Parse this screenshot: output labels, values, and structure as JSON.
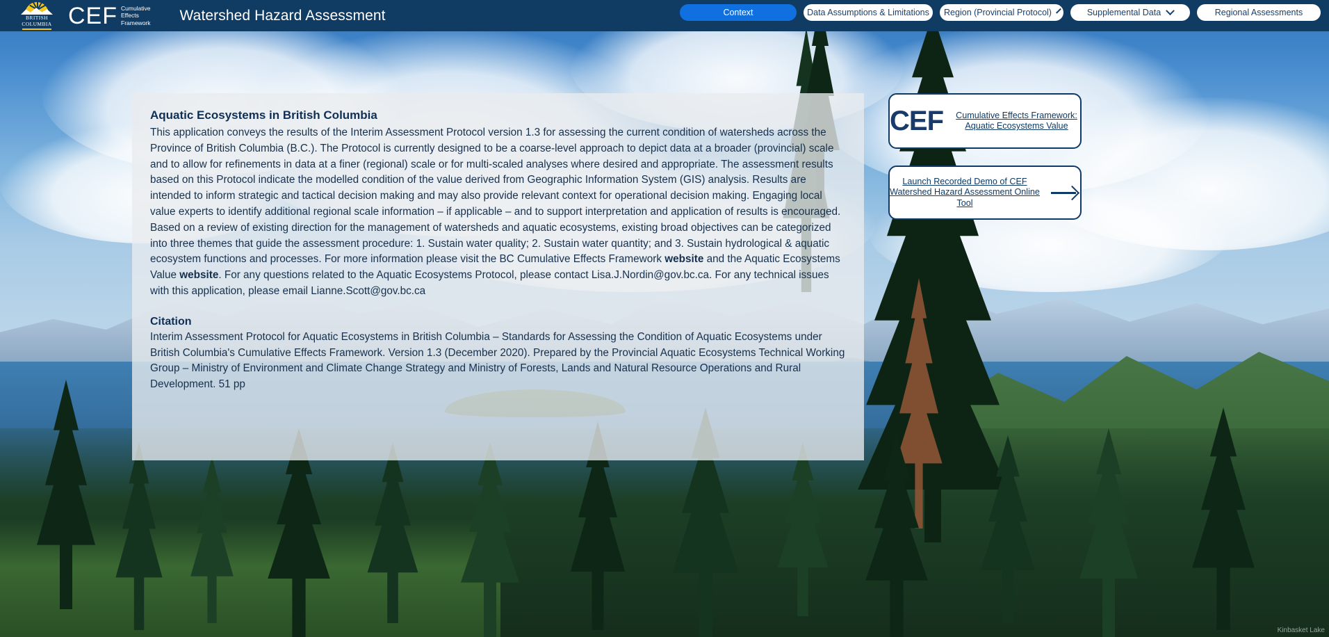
{
  "header": {
    "logo_text_lines": [
      "BRITISH",
      "COLUMBIA"
    ],
    "cef_acronym": "CEF",
    "cef_words": [
      "Cumulative",
      "Effects",
      "Framework"
    ],
    "app_title": "Watershed Hazard Assessment",
    "nav": [
      {
        "label": "Context",
        "active": true,
        "has_chevron": false
      },
      {
        "label": "Data Assumptions & Limitations",
        "active": false,
        "has_chevron": false
      },
      {
        "label": "Region (Provincial Protocol)",
        "active": false,
        "has_chevron": true
      },
      {
        "label": "Supplemental Data",
        "active": false,
        "has_chevron": true
      },
      {
        "label": "Regional Assessments",
        "active": false,
        "has_chevron": false
      }
    ]
  },
  "panel": {
    "title": "Aquatic Ecosystems in British Columbia",
    "body_part1": "This application conveys the results of the Interim Assessment Protocol version 1.3 for assessing the current condition of watersheds across the Province of British Columbia (B.C.). The Protocol is currently designed to be a coarse-level approach to depict data at a broader (provincial) scale and to allow for refinements in data at a finer (regional) scale or for multi-scaled analyses where desired and appropriate. The assessment results based on this Protocol indicate the modelled condition of the value derived from Geographic Information System (GIS) analysis. Results are intended to inform strategic and tactical decision making and may also provide relevant context for operational decision making. Engaging local value experts to identify additional regional scale information – if applicable – and to support interpretation and application of results is encouraged.  Based on a review of existing direction for the management of watersheds and aquatic ecosystems, existing broad objectives can be categorized into three themes that guide the assessment procedure: 1. Sustain water quality; 2. Sustain water quantity; and 3. Sustain hydrological & aquatic ecosystem functions and processes.  For more information please visit the BC Cumulative Effects Framework ",
    "link1": "website",
    "body_part2": " and the Aquatic Ecosystems Value ",
    "link2": "website",
    "body_part3": ". For any questions related to the Aquatic Ecosystems Protocol, please contact Lisa.J.Nordin@gov.bc.ca. For any technical issues with this application, please email Lianne.Scott@gov.bc.ca",
    "citation_heading": "Citation",
    "citation_body": "Interim Assessment Protocol for Aquatic Ecosystems in British Columbia – Standards for Assessing the Condition of Aquatic Ecosystems under British Columbia's Cumulative Effects Framework. Version 1.3 (December 2020). Prepared by the Provincial Aquatic Ecosystems Technical Working Group – Ministry of Environment and Climate Change Strategy and Ministry of Forests, Lands and Natural Resource Operations and Rural Development. 51 pp"
  },
  "cards": {
    "cef_card": {
      "acronym": "CEF",
      "link_label": "Cumulative Effects Framework: Aquatic Ecosystems Value"
    },
    "demo_card": {
      "link_label": "Launch Recorded Demo of CEF Watershed Hazard Assessment Online Tool",
      "arrow_icon": "arrow-right-icon"
    }
  },
  "watermark": "Kinbasket Lake",
  "colors": {
    "header_bg": "#103c64",
    "active_tab": "#1170e0",
    "panel_bg": "rgba(233,236,238,0.78)",
    "card_border": "#0f3a66",
    "text_dark": "#16304d"
  }
}
